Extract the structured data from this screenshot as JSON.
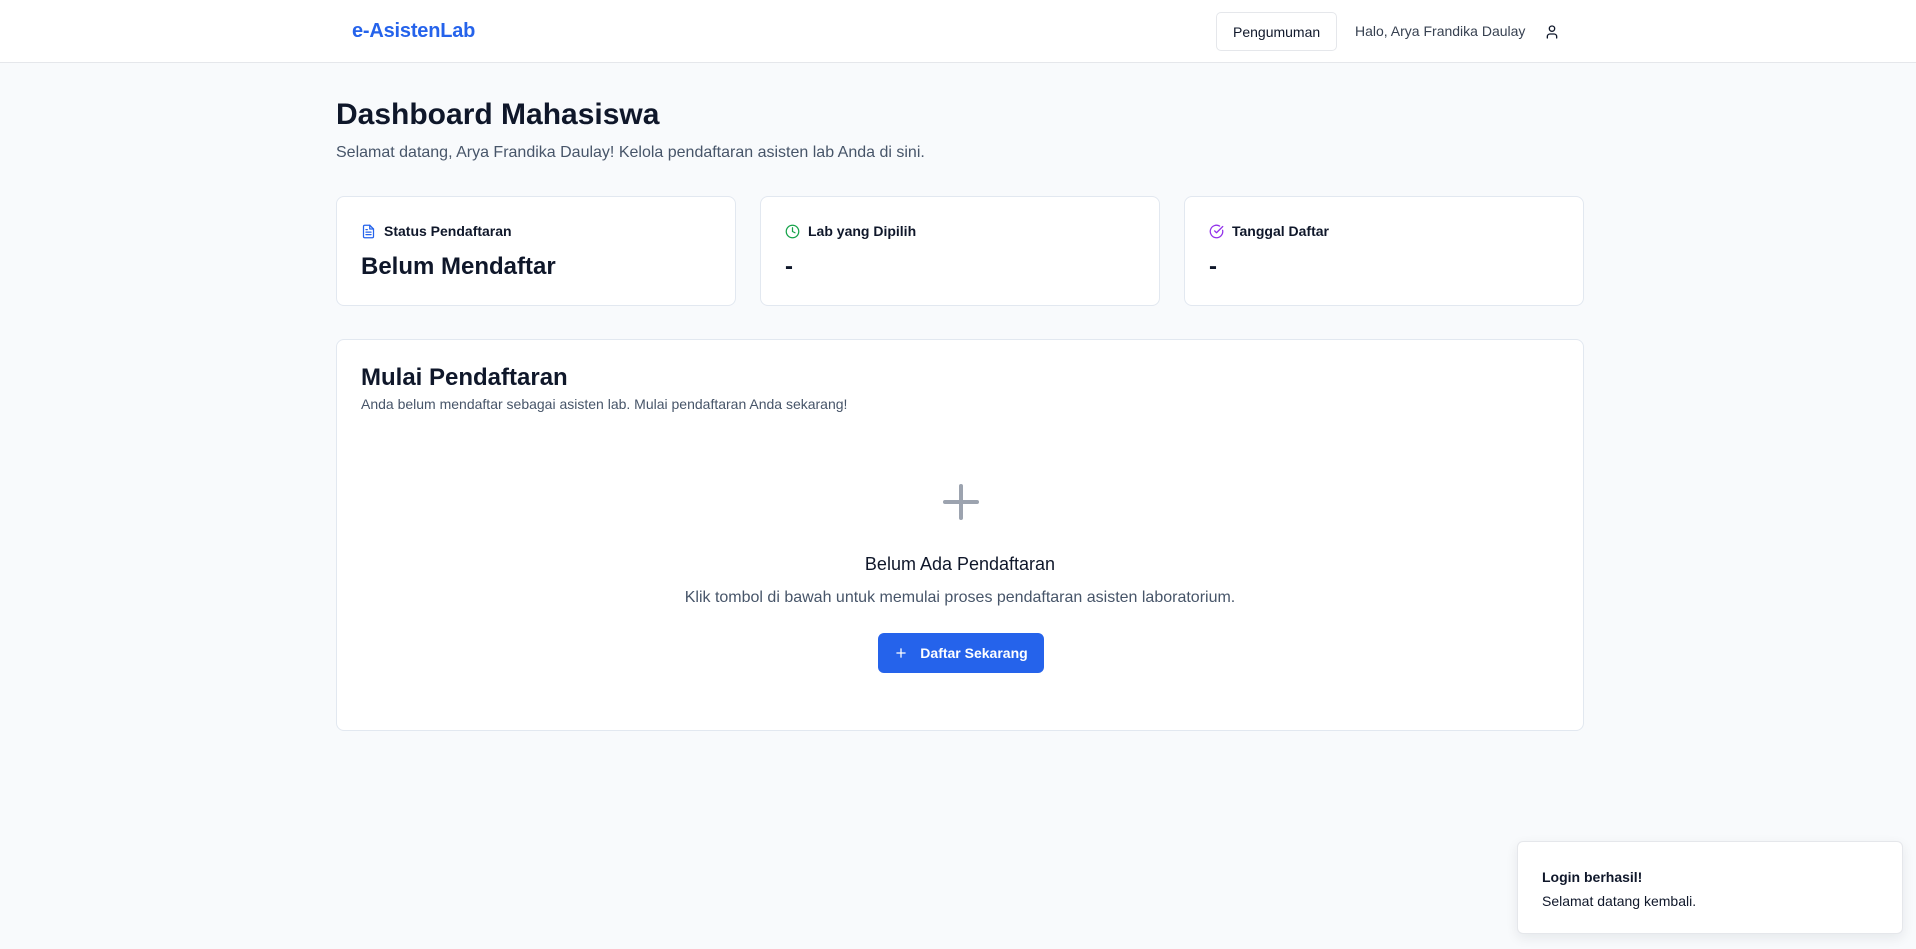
{
  "header": {
    "brand": "e-AsistenLab",
    "announcement_label": "Pengumuman",
    "greeting": "Halo, Arya Frandika Daulay",
    "user_icon": "user-icon"
  },
  "page": {
    "title": "Dashboard Mahasiswa",
    "subtitle": "Selamat datang, Arya Frandika Daulay! Kelola pendaftaran asisten lab Anda di sini."
  },
  "stats": [
    {
      "label": "Status Pendaftaran",
      "value": "Belum Mendaftar",
      "icon": "file-text-icon",
      "color": "#2563eb"
    },
    {
      "label": "Lab yang Dipilih",
      "value": "-",
      "icon": "clock-icon",
      "color": "#16a34a"
    },
    {
      "label": "Tanggal Daftar",
      "value": "-",
      "icon": "check-circle-icon",
      "color": "#9333ea"
    }
  ],
  "registration": {
    "title": "Mulai Pendaftaran",
    "description": "Anda belum mendaftar sebagai asisten lab. Mulai pendaftaran Anda sekarang!",
    "empty_icon": "plus-icon",
    "empty_title": "Belum Ada Pendaftaran",
    "empty_description": "Klik tombol di bawah untuk memulai proses pendaftaran asisten laboratorium.",
    "cta_label": "Daftar Sekarang"
  },
  "toast": {
    "title": "Login berhasil!",
    "message": "Selamat datang kembali."
  },
  "colors": {
    "accent": "#2563eb",
    "background": "#f8fafc",
    "border": "#e2e8f0",
    "muted_text": "#475569",
    "empty_icon": "#9ca3af"
  }
}
